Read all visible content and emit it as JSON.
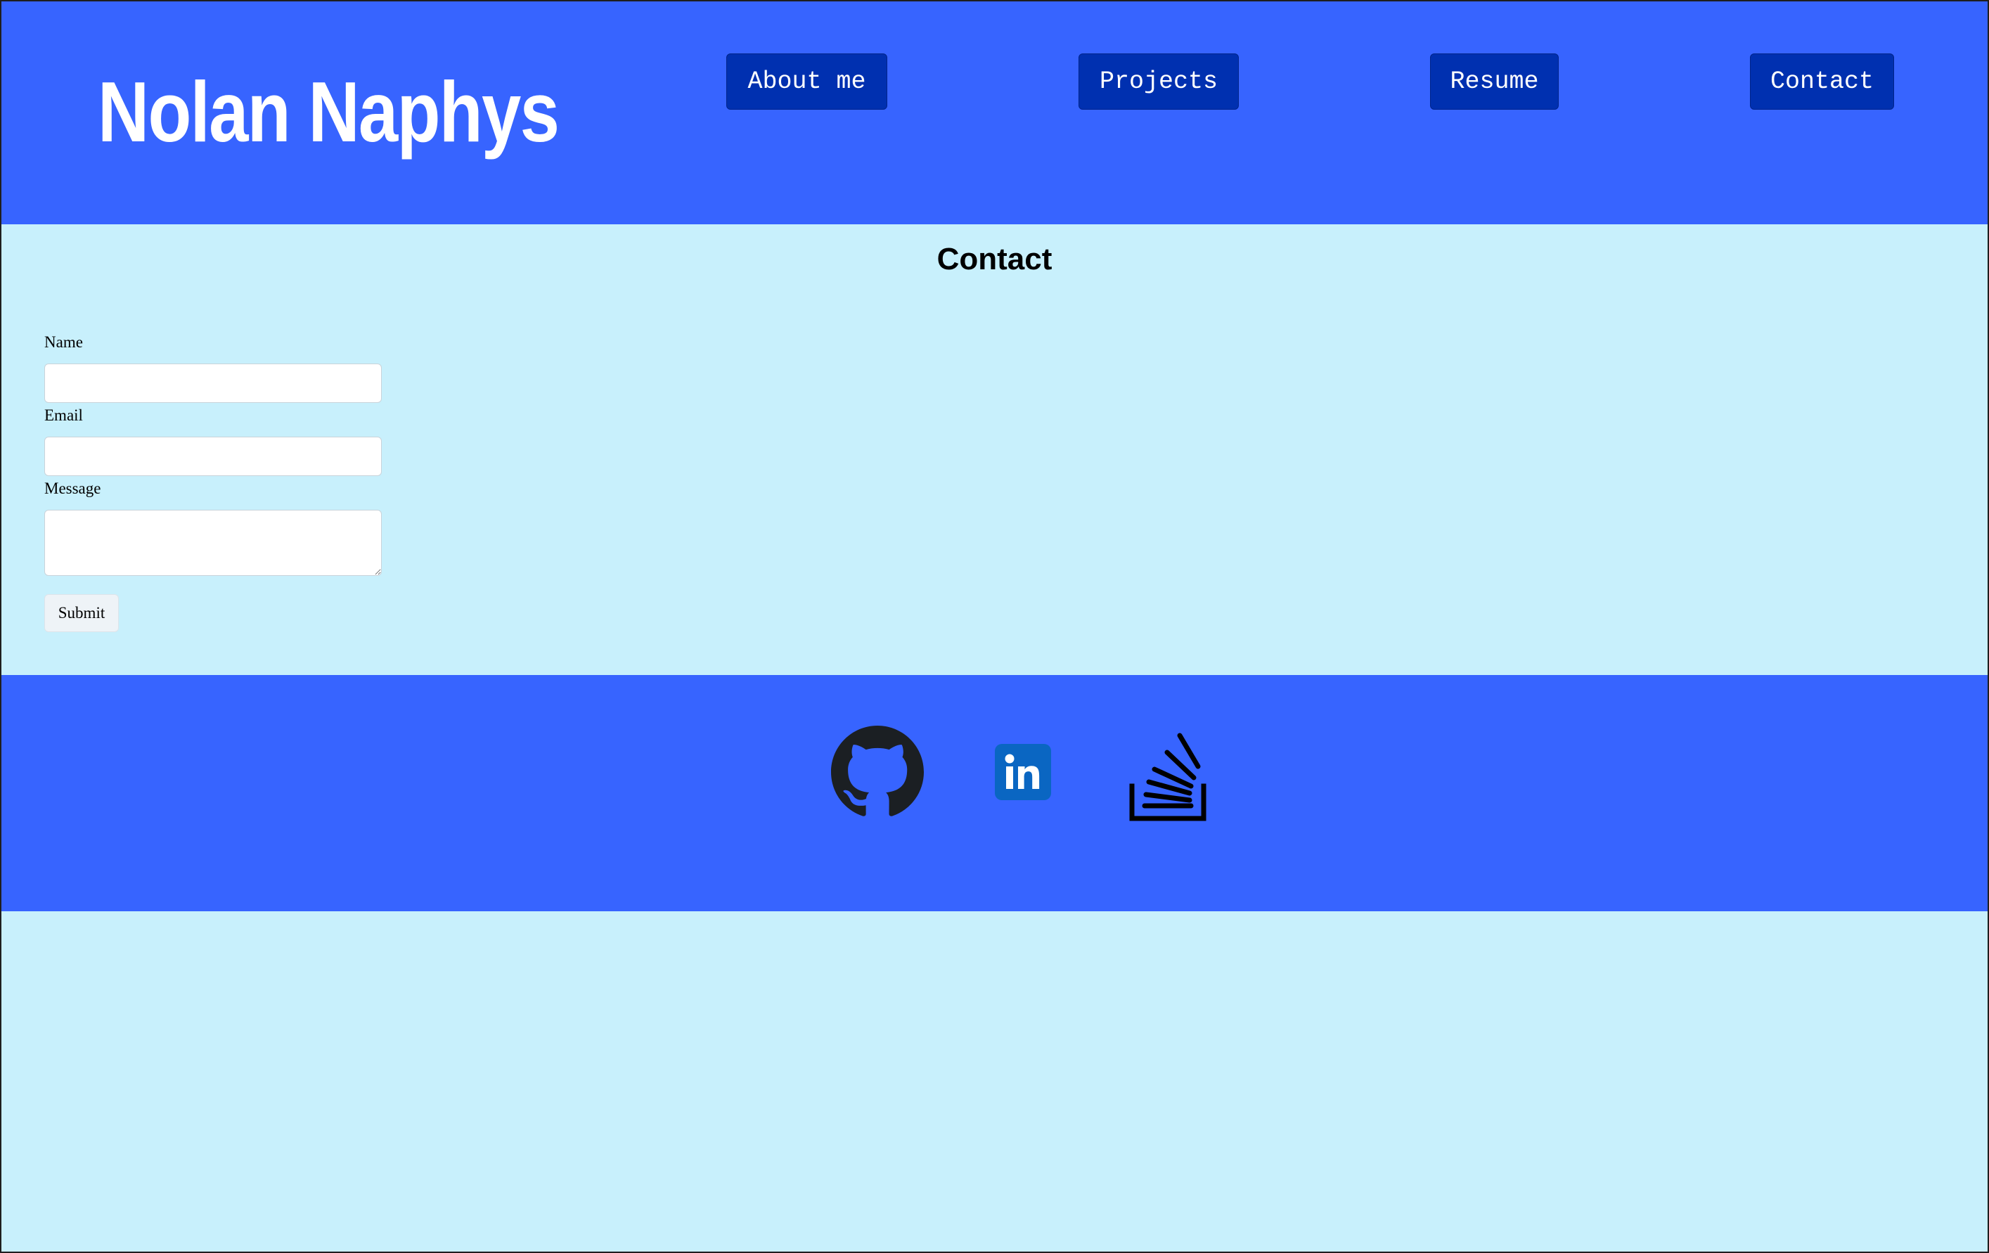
{
  "header": {
    "site_title": "Nolan Naphys",
    "nav": {
      "about": "About me",
      "projects": "Projects",
      "resume": "Resume",
      "contact": "Contact"
    }
  },
  "contact": {
    "title": "Contact",
    "form": {
      "name_label": "Name",
      "name_value": "",
      "email_label": "Email",
      "email_value": "",
      "message_label": "Message",
      "message_value": "",
      "submit_label": "Submit"
    }
  },
  "footer": {
    "social_icons": [
      "github-icon",
      "linkedin-icon",
      "stackoverflow-icon"
    ]
  },
  "colors": {
    "header_bg": "#3764ff",
    "nav_button_bg": "#0030b0",
    "page_bg": "#c8f0fc",
    "linkedin_blue": "#0a66c2",
    "icon_dark": "#1b1f23"
  }
}
